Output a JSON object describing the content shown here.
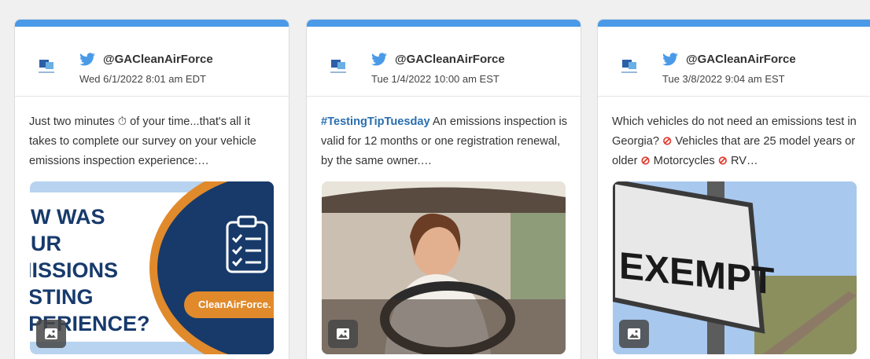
{
  "posts": [
    {
      "handle": "@GACleanAirForce",
      "date": "Wed 6/1/2022 8:01 am EDT",
      "text": "Just two minutes ⏱ of your time...that's all it takes to complete our survey on your vehicle emissions inspection experience:…",
      "image": {
        "headline_lines": [
          "OW WAS",
          "OUR",
          "MISSIONS",
          "ESTING",
          "XPERIENCE?"
        ],
        "pill": "CleanAirForce."
      }
    },
    {
      "handle": "@GACleanAirForce",
      "date": "Tue 1/4/2022 10:00 am EST",
      "hashtag": "#TestingTipTuesday",
      "text": " An emissions inspection is valid for 12 months or one registration renewal, by the same owner.…"
    },
    {
      "handle": "@GACleanAirForce",
      "date": "Tue 3/8/2022 9:04 am EST",
      "text_parts": [
        "Which vehicles do not need an emissions test in Georgia? ",
        " Vehicles that are 25 model years or older ",
        " Motorcycles ",
        " RV…"
      ],
      "no_symbol": "⃠",
      "sign_text": "EXEMPT"
    }
  ],
  "colors": {
    "accent": "#4a9ae8",
    "twitter": "#4a9ae8",
    "hashtag": "#2a6fb0",
    "navy": "#173a6b",
    "orange": "#e08a2c"
  },
  "icons": {
    "network": "twitter-bird-icon",
    "media": "image-icon"
  }
}
